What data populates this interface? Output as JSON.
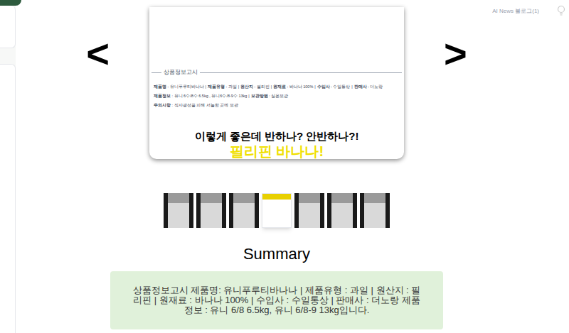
{
  "header": {
    "text": "AI News 블로그(1)"
  },
  "carousel": {
    "prev": "<",
    "next": ">",
    "slide": {
      "notice_title": "상품정보고시",
      "separator": "|",
      "notice_rows": [
        [
          {
            "label": "제품명",
            "value": " : 유니푸루티바나나"
          },
          {
            "label": "제품유형",
            "value": " : 과일"
          },
          {
            "label": "원산지",
            "value": " : 필리핀"
          },
          {
            "label": "원재료",
            "value": " : 바나나 100%"
          },
          {
            "label": "수입사",
            "value": " : 수일통상"
          },
          {
            "label": "판매사",
            "value": " : 더노랑"
          }
        ],
        [
          {
            "label": "제품정보",
            "value": " : 유니 6수/8수 6.5kg , 유니6수/8-9수 13kg"
          },
          {
            "label": "보관방법",
            "value": " : 실온보관"
          }
        ],
        [
          {
            "label": "주의사항",
            "value": " : 직사광선을 피해 서늘한 곳에 보관"
          }
        ]
      ],
      "headline": "이렇게 좋은데 반하나? 안반하나?!",
      "highlight": "필리핀 바나나!"
    }
  },
  "thumbnails": [
    {
      "selected": false
    },
    {
      "selected": false
    },
    {
      "selected": false
    },
    {
      "selected": true
    },
    {
      "selected": false
    },
    {
      "selected": false
    },
    {
      "selected": false
    }
  ],
  "summary": {
    "title": "Summary",
    "text": "상품정보고시 제품명: 유니푸루티바나나 | 제품유형 : 과일 | 원산지 : 필리핀 | 원재료 : 바나나 100% | 수입사 : 수일통상 | 판매사 : 더노랑 제품정보 : 유니 6/8 6.5kg, 유니 6/8-9 13kg입니다."
  }
}
